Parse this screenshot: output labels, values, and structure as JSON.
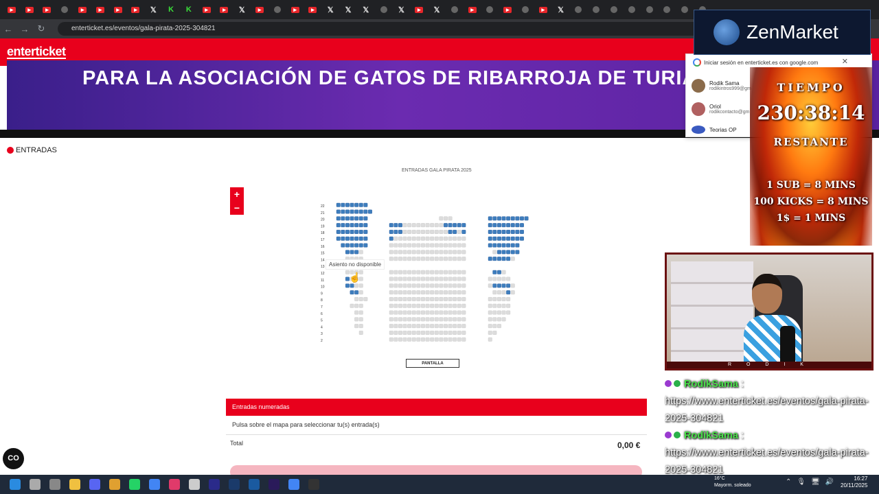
{
  "browser": {
    "url": "enterticket.es/eventos/gala-pirata-2025-304821"
  },
  "site": {
    "logo": "enterticket",
    "banner_text": "PARA LA ASOCIACIÓN DE GATOS DE RIBARROJA DE TURIA (V",
    "section_label": "ENTRADAS",
    "event_title": "ENTRADAS GALA PIRATA 2025",
    "zoom_in": "+",
    "zoom_out": "−",
    "tooltip": "Asiento no disponible",
    "screen_label": "PANTALLA",
    "numbered_header": "Entradas numeradas",
    "hint": "Pulsa sobre el mapa para seleccionar tu(s) entrada(s)",
    "total_label": "Total",
    "total_value": "0,00 €",
    "copilot_icon": "co-icon",
    "row_labels": [
      "22",
      "21",
      "20",
      "19",
      "18",
      "17",
      "16",
      "15",
      "14",
      "13",
      "12",
      "11",
      "10",
      "9",
      "8",
      "7",
      "6",
      "5",
      "4",
      "3",
      "2"
    ],
    "seat_colors": {
      "available": "#3d7dbd",
      "unavailable": "#dcdcdc"
    }
  },
  "google_signin": {
    "title": "Iniciar sesión en enterticket.es con google.com",
    "accounts": [
      {
        "name": "Rodik Sama",
        "email": "rodikintros999@gm"
      },
      {
        "name": "Oriol",
        "email": "rodikcontacto@gm"
      },
      {
        "name": "Teorias OP",
        "email": ""
      }
    ]
  },
  "overlay": {
    "sponsor": "ZenMarket",
    "timer_label": "TIEMPO",
    "timer_value": "230:38:14",
    "timer_sub": "RESTANTE",
    "rules": [
      "1 SUB = 8 MINS",
      "100 KICKS = 8 MINS",
      "1$ = 1 MINS"
    ],
    "cam_label": "R O D I K",
    "chat": [
      {
        "user": "RodikSama",
        "text": "https://www.enterticket.es/eventos/gala-pirata-2025-304821"
      },
      {
        "user": "RodikSama",
        "text": "https://www.enterticket.es/eventos/gala-pirata-2025-304821"
      }
    ]
  },
  "taskbar": {
    "weather_temp": "16°C",
    "weather_desc": "Mayorm. soleado",
    "time": "16:27",
    "date": "20/11/2025"
  }
}
